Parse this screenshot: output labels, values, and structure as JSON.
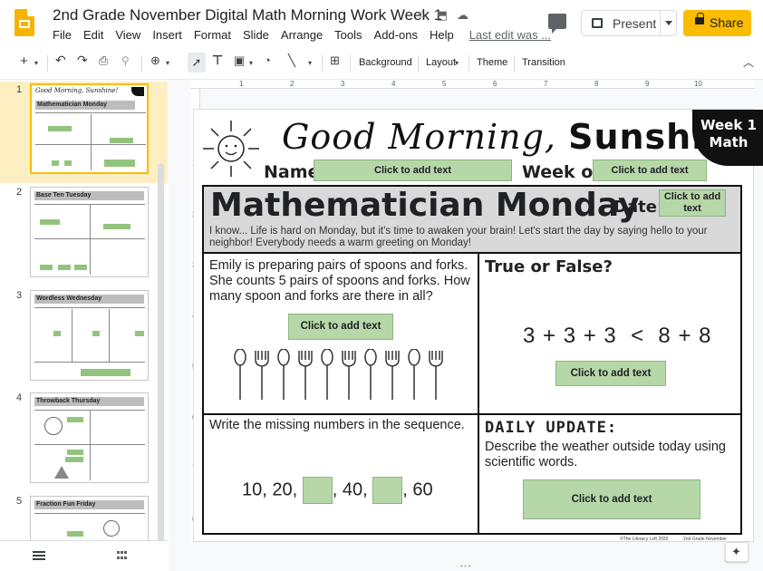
{
  "doc": {
    "title": "2nd Grade November Digital Math Morning Work Week 1"
  },
  "menu": [
    "File",
    "Edit",
    "View",
    "Insert",
    "Format",
    "Slide",
    "Arrange",
    "Tools",
    "Add-ons",
    "Help"
  ],
  "menu_last_edit": "Last edit was ...",
  "header": {
    "present_label": "Present",
    "share_label": "Share"
  },
  "toolbar": {
    "background": "Background",
    "layout": "Layout",
    "theme": "Theme",
    "transition": "Transition"
  },
  "filmstrip": {
    "slides": [
      {
        "number": "1",
        "title": "Mathematician Monday",
        "selected": true
      },
      {
        "number": "2",
        "title": "Base Ten Tuesday",
        "selected": false
      },
      {
        "number": "3",
        "title": "Wordless Wednesday",
        "selected": false
      },
      {
        "number": "4",
        "title": "Throwback Thursday",
        "selected": false
      },
      {
        "number": "5",
        "title": "Fraction Fun Friday",
        "selected": false
      }
    ],
    "thumb1_header": "Good Morning, Sunshine!"
  },
  "ruler": {
    "h": [
      "1",
      "2",
      "3",
      "4",
      "5",
      "6",
      "7",
      "8",
      "9",
      "10"
    ],
    "v": [
      "1",
      "2",
      "3",
      "4",
      "5",
      "6",
      "7",
      "8"
    ]
  },
  "slide": {
    "good_morning_script": "Good Morning,",
    "good_morning_bold": "Sunshine!",
    "name_label": "Name",
    "week_of_label": "Week of",
    "badge_line1": "Week 1",
    "badge_line2": "Math",
    "placeholder": "Click to add text",
    "date_placeholder": "Click to add text",
    "day_title": "Mathematician Monday",
    "date_label": "Date:",
    "intro": "I know... Life is hard on Monday, but it's time to awaken your brain! Let's start the day by saying hello to your neighbor! Everybody needs a warm greeting on Monday!",
    "q1": "Emily is preparing pairs of spoons and forks. She counts 5 pairs of spoons and forks. How many spoon and forks are there in all?",
    "true_false_title": "True or False?",
    "equation": "3 + 3 + 3  <  8 + 8",
    "q3": "Write the missing numbers in the sequence.",
    "seq_a": "10, 20,",
    "seq_b": ", 40,",
    "seq_c": ", 60",
    "daily_title": "DAILY UPDATE:",
    "daily_text": "Describe the weather outside today using scientific words.",
    "footer_left": "©The Literacy Loft 2020",
    "footer_right": "2nd Grade November"
  },
  "colors": {
    "accent_yellow": "#fbbc04",
    "selected_slide_bg": "#feefc3",
    "answer_green": "#b6d7a8",
    "banner_gray": "#d9d9d9"
  }
}
